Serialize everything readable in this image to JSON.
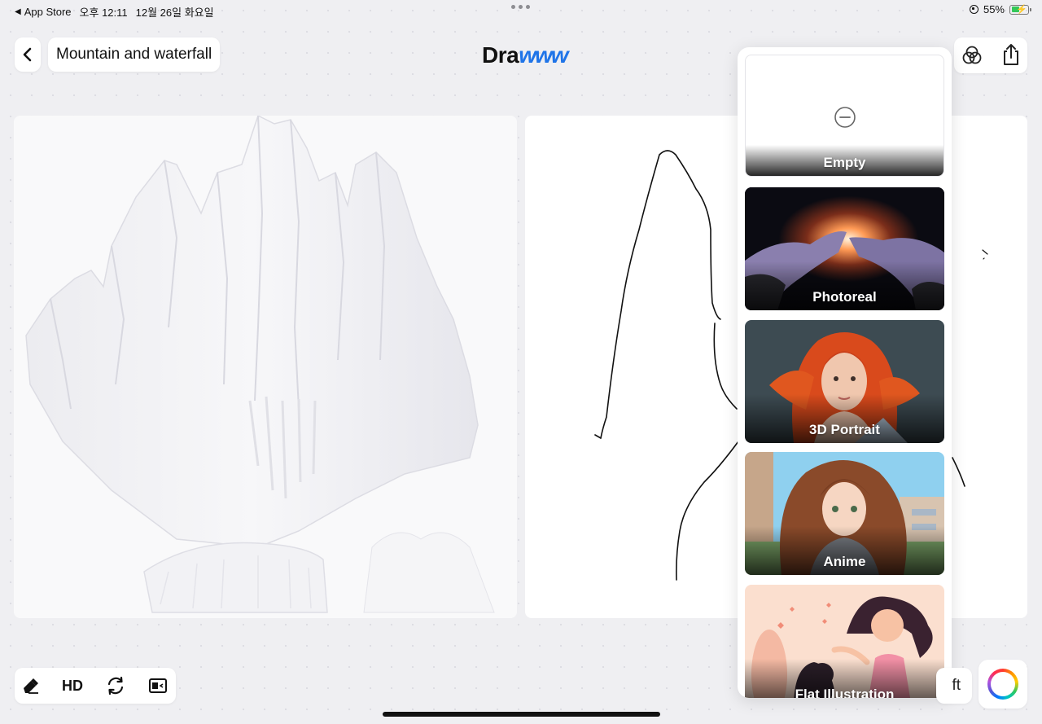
{
  "status_bar": {
    "back_app": "App Store",
    "time": "오후 12:11",
    "date": "12월 26일 화요일",
    "battery_percent": "55%",
    "battery_level": 0.55
  },
  "header": {
    "drawing_title": "Mountain and waterfall",
    "logo_main": "Dra",
    "logo_accent": "www",
    "accent_color": "#1f74e8"
  },
  "style_menu": {
    "items": [
      {
        "label": "Empty",
        "icon": "minus-circle-icon"
      },
      {
        "label": "Photoreal"
      },
      {
        "label": "3D Portrait"
      },
      {
        "label": "Anime"
      },
      {
        "label": "Flat Illustration"
      }
    ]
  },
  "toolbar": {
    "eraser_icon": "eraser-icon",
    "hd_label": "HD",
    "refresh_icon": "refresh-icon",
    "layout_icon": "layout-toggle-icon",
    "draft_label": "ft"
  },
  "icons": {
    "back": "chevron-left-icon",
    "style": "style-circles-icon",
    "share": "share-icon",
    "color": "color-wheel-icon"
  }
}
